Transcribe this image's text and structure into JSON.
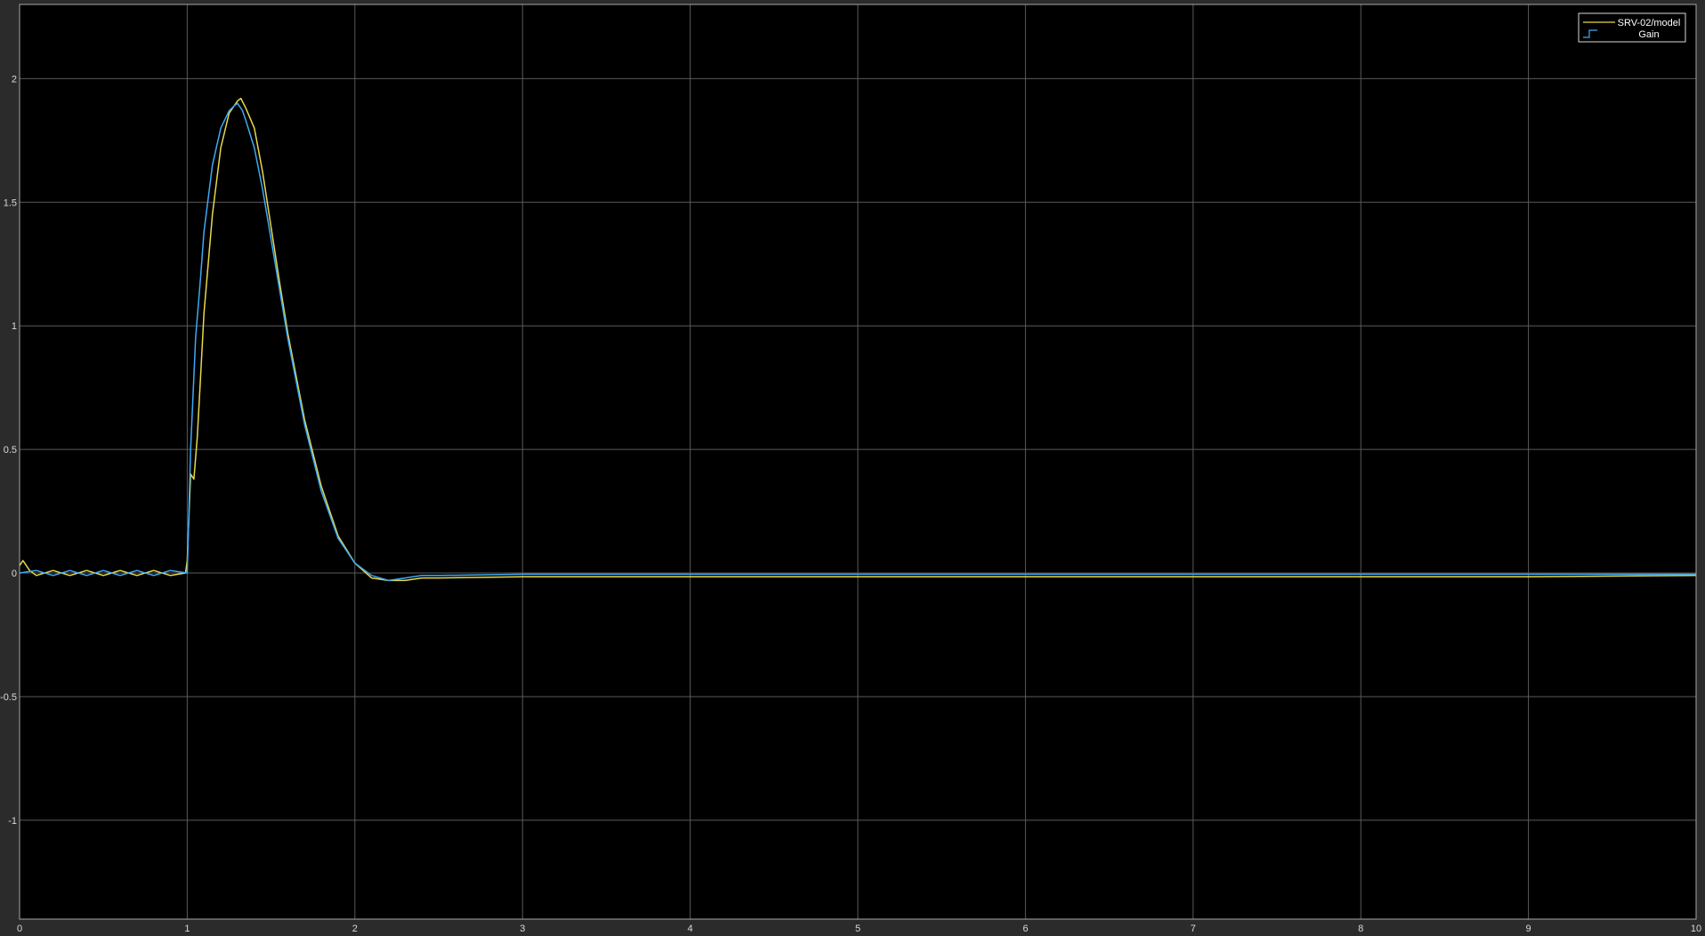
{
  "colors": {
    "background": "#2b2b2b",
    "axes_background": "#000000",
    "grid": "#5a5a5a",
    "axis_frame": "#a6a6a6",
    "tick_label": "#d9d9d9"
  },
  "chart_data": {
    "type": "line",
    "title": "",
    "xlabel": "",
    "ylabel": "",
    "xlim": [
      0,
      10
    ],
    "ylim": [
      -1.4,
      2.3
    ],
    "grid": true,
    "legend_position": "top-right",
    "x_ticks": [
      0,
      1,
      2,
      3,
      4,
      5,
      6,
      7,
      8,
      9,
      10
    ],
    "y_ticks": [
      -1,
      -0.5,
      0,
      0.5,
      1,
      1.5,
      2
    ],
    "x_tick_labels": [
      "0",
      "1",
      "2",
      "3",
      "4",
      "5",
      "6",
      "7",
      "8",
      "9",
      "10"
    ],
    "y_tick_labels": [
      "-1",
      "-0.5",
      "0",
      "0.5",
      "1",
      "1.5",
      "2"
    ],
    "series": [
      {
        "name": "SRV-02/model",
        "color": "#e6d84a",
        "legend_icon": "line",
        "x": [
          0,
          0.02,
          0.06,
          0.1,
          0.2,
          0.3,
          0.4,
          0.5,
          0.6,
          0.7,
          0.8,
          0.9,
          0.99,
          1.0,
          1.02,
          1.04,
          1.06,
          1.08,
          1.1,
          1.15,
          1.2,
          1.25,
          1.3,
          1.32,
          1.35,
          1.4,
          1.45,
          1.5,
          1.55,
          1.6,
          1.7,
          1.8,
          1.9,
          2.0,
          2.1,
          2.2,
          2.3,
          2.4,
          2.5,
          3.0,
          4.0,
          5.0,
          6.0,
          7.0,
          8.0,
          9.0,
          10.0
        ],
        "y": [
          0.03,
          0.05,
          0.01,
          -0.01,
          0.01,
          -0.01,
          0.01,
          -0.01,
          0.01,
          -0.01,
          0.01,
          -0.01,
          0.0,
          0.05,
          0.4,
          0.38,
          0.55,
          0.8,
          1.05,
          1.45,
          1.72,
          1.86,
          1.91,
          1.92,
          1.88,
          1.8,
          1.62,
          1.4,
          1.18,
          0.97,
          0.62,
          0.35,
          0.15,
          0.04,
          -0.02,
          -0.03,
          -0.03,
          -0.02,
          -0.02,
          -0.015,
          -0.015,
          -0.015,
          -0.015,
          -0.015,
          -0.015,
          -0.015,
          -0.01
        ]
      },
      {
        "name": "Gain",
        "color": "#3fa9f5",
        "legend_icon": "step",
        "x": [
          0,
          0.1,
          0.2,
          0.3,
          0.4,
          0.5,
          0.6,
          0.7,
          0.8,
          0.9,
          1.0,
          1.02,
          1.05,
          1.08,
          1.1,
          1.15,
          1.2,
          1.25,
          1.28,
          1.3,
          1.33,
          1.35,
          1.4,
          1.45,
          1.5,
          1.6,
          1.7,
          1.8,
          1.9,
          2.0,
          2.1,
          2.2,
          2.3,
          2.4,
          2.5,
          3.0,
          4.0,
          5.0,
          6.0,
          7.0,
          8.0,
          9.0,
          10.0
        ],
        "y": [
          0.0,
          0.01,
          -0.01,
          0.01,
          -0.01,
          0.01,
          -0.01,
          0.01,
          -0.01,
          0.01,
          0.0,
          0.5,
          0.95,
          1.2,
          1.38,
          1.65,
          1.8,
          1.87,
          1.89,
          1.9,
          1.87,
          1.83,
          1.72,
          1.55,
          1.35,
          0.95,
          0.6,
          0.33,
          0.14,
          0.04,
          -0.01,
          -0.03,
          -0.02,
          -0.01,
          -0.01,
          -0.005,
          -0.005,
          -0.005,
          -0.005,
          -0.005,
          -0.005,
          -0.005,
          -0.005
        ]
      }
    ]
  }
}
